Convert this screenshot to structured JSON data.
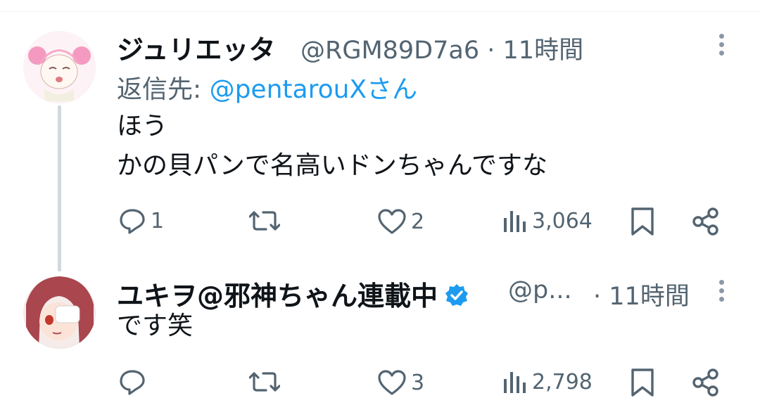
{
  "tweets": [
    {
      "display_name": "ジュリエッタ",
      "handle": "@RGM89D7a6",
      "time_sep": "·",
      "time": "11時間",
      "reply_label": "返信先: ",
      "reply_mention": "@pentarouXさん",
      "body_lines": [
        "ほう",
        "かの貝パンで名高いドンちゃんですな"
      ],
      "replies": "1",
      "likes": "2",
      "views": "3,064"
    },
    {
      "display_name": "ユキヲ@邪神ちゃん連載中",
      "verified": true,
      "handle": "@p...",
      "time_sep": "·",
      "time": "11時間",
      "body_lines": [
        "です笑"
      ],
      "likes": "3",
      "views": "2,798"
    }
  ],
  "icons": {
    "more": "more-vertical-icon",
    "reply": "reply-icon",
    "retweet": "retweet-icon",
    "like": "heart-icon",
    "views": "views-chart-icon",
    "bookmark": "bookmark-icon",
    "share": "share-icon",
    "verified": "verified-badge-icon"
  },
  "colors": {
    "text": "#0f1419",
    "secondary": "#536471",
    "link": "#1d9bf0",
    "thread": "#cfd9de"
  }
}
